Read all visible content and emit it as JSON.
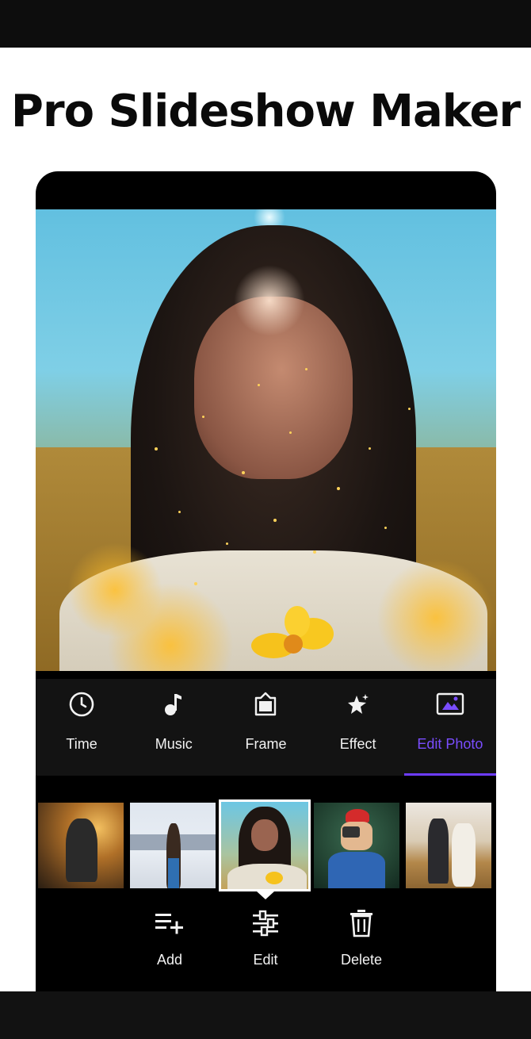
{
  "headline": "Pro Slideshow Maker",
  "tabs": [
    {
      "label": "Time",
      "icon": "clock-icon"
    },
    {
      "label": "Music",
      "icon": "music-note-icon"
    },
    {
      "label": "Frame",
      "icon": "frame-icon"
    },
    {
      "label": "Effect",
      "icon": "sparkle-effect-icon"
    },
    {
      "label": "Edit Photo",
      "icon": "image-edit-icon",
      "active": true
    }
  ],
  "photos": [
    {
      "name": "photo-hooded-field"
    },
    {
      "name": "photo-girl-rooftop"
    },
    {
      "name": "photo-girl-hair-blowing",
      "selected": true
    },
    {
      "name": "photo-girl-camera"
    },
    {
      "name": "photo-couple-field"
    }
  ],
  "actions": {
    "add": "Add",
    "edit": "Edit",
    "delete": "Delete"
  },
  "colors": {
    "accent": "#6d3cff",
    "active_label": "#7a4dff",
    "tab_bar": "#131313",
    "phone_bg": "#000000"
  }
}
